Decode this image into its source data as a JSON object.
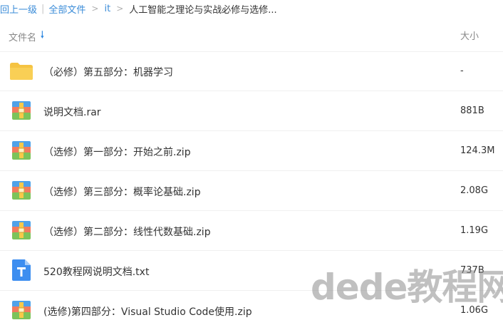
{
  "breadcrumb": {
    "back": "回上一级",
    "all_files": "全部文件",
    "folder": "it",
    "current": "人工智能之理论与实战必修与选修...",
    "bar": "|",
    "arrow": ">"
  },
  "header": {
    "name_label": "文件名",
    "sort_icon": "arrow-down-icon",
    "size_label": "大小"
  },
  "rows": [
    {
      "icon": "folder-icon",
      "name": "（必修）第五部分：机器学习",
      "size": "-"
    },
    {
      "icon": "archive-icon",
      "name": "说明文档.rar",
      "size": "881B"
    },
    {
      "icon": "archive-icon",
      "name": "（选修）第一部分：开始之前.zip",
      "size": "124.3M"
    },
    {
      "icon": "archive-icon",
      "name": "（选修）第三部分：概率论基础.zip",
      "size": "2.08G"
    },
    {
      "icon": "archive-icon",
      "name": "（选修）第二部分：线性代数基础.zip",
      "size": "1.19G"
    },
    {
      "icon": "text-file-icon",
      "name": "520教程网说明文档.txt",
      "size": "737B"
    },
    {
      "icon": "archive-icon",
      "name": "(选修)第四部分：Visual Studio Code使用.zip",
      "size": "1.06G"
    }
  ],
  "watermark": "dede教程网",
  "colors": {
    "link": "#3b8cd8",
    "folder": "#f5c342",
    "txt_icon": "#3d8ef0"
  }
}
